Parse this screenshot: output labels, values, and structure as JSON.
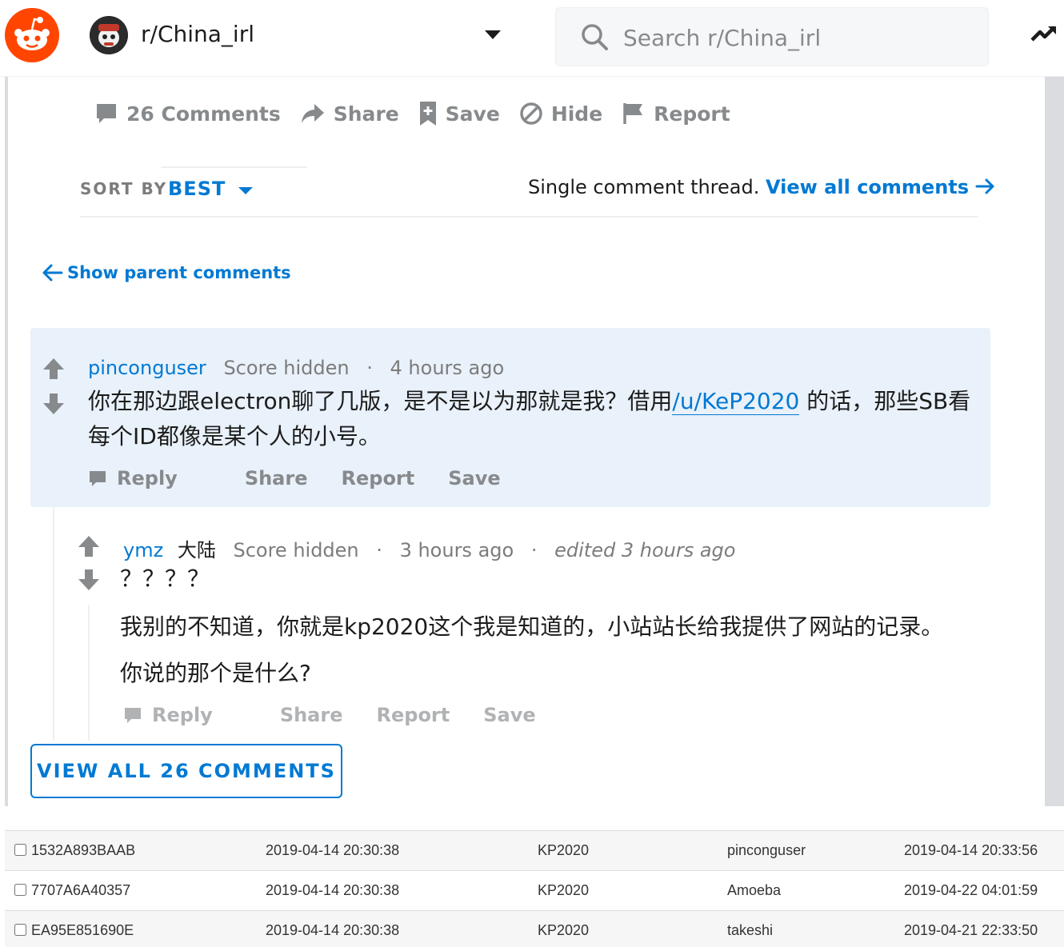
{
  "header": {
    "subreddit_name": "r/China_irl",
    "search_placeholder": "Search r/China_irl",
    "logo_icon": "reddit-snoo-icon",
    "trending_icon": "trending-icon"
  },
  "post_actions": {
    "comments": "26 Comments",
    "share": "Share",
    "save": "Save",
    "hide": "Hide",
    "report": "Report"
  },
  "sort": {
    "label": "SORT BY",
    "value": "BEST",
    "thread_note": "Single comment thread.",
    "view_all_link": "View all comments"
  },
  "show_parent": "Show parent comments",
  "comments": [
    {
      "author": "pinconguser",
      "score": "Score hidden",
      "time": "4 hours ago",
      "body_before": "你在那边跟electron聊了几版，是不是以为那就是我？借用",
      "mention": "/u/KeP2020",
      "body_after": " 的话，那些SB看每个ID都像是某个人的小号。",
      "actions": [
        "Reply",
        "Share",
        "Report",
        "Save"
      ]
    },
    {
      "author": "ymz",
      "flair": "大陆",
      "score": "Score hidden",
      "time": "3 hours ago",
      "edited": "edited 3 hours ago",
      "line1": "？？？？",
      "line2": "我别的不知道，你就是kp2020这个我是知道的，小站站长给我提供了网站的记录。",
      "line3": "你说的那个是什么?",
      "actions": [
        "Reply",
        "Share",
        "Report",
        "Save"
      ]
    }
  ],
  "view_all_button": "VIEW ALL 26 COMMENTS",
  "records": [
    [
      "1532A893BAAB",
      "2019-04-14 20:30:38",
      "KP2020",
      "pinconguser",
      "2019-04-14 20:33:56"
    ],
    [
      "7707A6A40357",
      "2019-04-14 20:30:38",
      "KP2020",
      "Amoeba",
      "2019-04-22 04:01:59"
    ],
    [
      "EA95E851690E",
      "2019-04-14 20:30:38",
      "KP2020",
      "takeshi",
      "2019-04-21 22:33:50"
    ]
  ],
  "colors": {
    "brand": "#ff4500",
    "link": "#0079d3",
    "muted": "#878a8c",
    "highlight_bg": "#e9f1fa"
  }
}
